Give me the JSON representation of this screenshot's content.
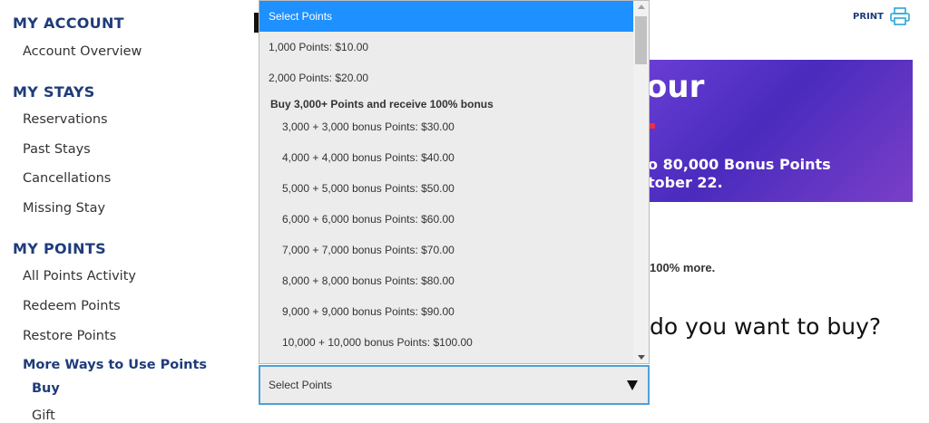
{
  "sidebar": {
    "sections": [
      {
        "title": "MY ACCOUNT",
        "items": [
          "Account Overview"
        ]
      },
      {
        "title": "MY STAYS",
        "items": [
          "Reservations",
          "Past Stays",
          "Cancellations",
          "Missing Stay"
        ]
      },
      {
        "title": "MY POINTS",
        "items": [
          "All Points Activity",
          "Redeem Points",
          "Restore Points",
          "More Ways to Use Points"
        ]
      }
    ],
    "subitems": [
      "Buy",
      "Gift"
    ]
  },
  "header": {
    "print_label": "PRINT"
  },
  "banner": {
    "headline": "our",
    "line1": "o 80,000 Bonus Points",
    "line2": "tober 22."
  },
  "main": {
    "more_text": "100% more.",
    "question": "do you want to buy?"
  },
  "dropdown": {
    "options": [
      "Select Points",
      "1,000 Points: $10.00",
      "2,000 Points: $20.00",
      "3,000 + 3,000 bonus Points: $30.00",
      "4,000 + 4,000 bonus Points: $40.00",
      "5,000 + 5,000 bonus Points: $50.00",
      "6,000 + 6,000 bonus Points: $60.00",
      "7,000 + 7,000 bonus Points: $70.00",
      "8,000 + 8,000 bonus Points: $80.00",
      "9,000 + 9,000 bonus Points: $90.00",
      "10,000 + 10,000 bonus Points: $100.00"
    ],
    "group_label": "Buy 3,000+ Points and receive 100% bonus"
  },
  "select": {
    "value": "Select Points"
  },
  "colors": {
    "brand": "#1f3c7a",
    "highlight": "#1e90ff",
    "focus_border": "#4ea0d9",
    "banner": "#5a35c8"
  }
}
